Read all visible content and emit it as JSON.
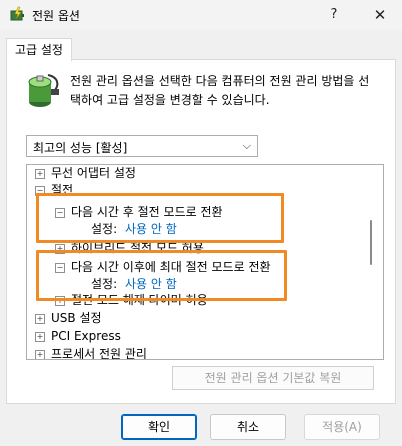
{
  "window": {
    "title": "전원 옵션",
    "help_label": "?",
    "close_label": "✕"
  },
  "tab": {
    "label": "고급 설정"
  },
  "description": "전원 관리 옵션을 선택한 다음 컴퓨터의 전원 관리 방법을 선택하여 고급 설정을 변경할 수 있습니다.",
  "plan_dropdown": {
    "value": "최고의 성능 [활성]",
    "arrow": "⌵"
  },
  "tree": {
    "items": [
      {
        "label": "무선 어댑터 설정",
        "toggle": "+"
      },
      {
        "label": "절전",
        "toggle": "−"
      },
      {
        "label": "다음 시간 후 절전 모드로 전환",
        "toggle": "−"
      },
      {
        "setting_label": "설정:",
        "setting_value": "사용 안 함"
      },
      {
        "label": "하이브리드 절전 모드 허용",
        "toggle": "+"
      },
      {
        "label": "다음 시간 이후에 최대 절전 모드로 전환",
        "toggle": "−"
      },
      {
        "setting_label": "설정:",
        "setting_value": "사용 안 함"
      },
      {
        "label": "절전 모드 해제 타이머 허용",
        "toggle": "+"
      },
      {
        "label": "USB 설정",
        "toggle": "+"
      },
      {
        "label": "PCI Express",
        "toggle": "+"
      },
      {
        "label": "프로세서 전원 관리",
        "toggle": "+"
      }
    ]
  },
  "restore_button": "전원 관리 옵션 기본값 복원",
  "buttons": {
    "ok": "확인",
    "cancel": "취소",
    "apply": "적용(A)"
  },
  "colors": {
    "highlight": "#f08a24",
    "setting_value": "#0067c0"
  }
}
